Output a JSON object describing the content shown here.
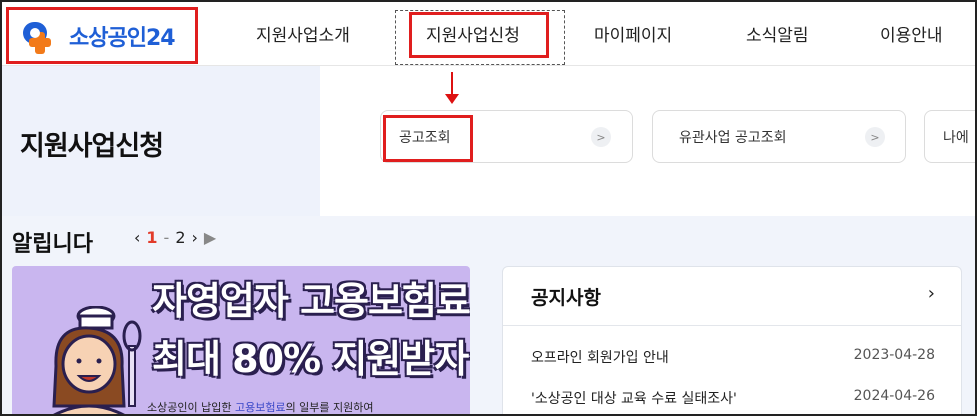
{
  "header": {
    "logo_text": "소상공인24",
    "nav": [
      "지원사업소개",
      "지원사업신청",
      "마이페이지",
      "소식알림",
      "이용안내"
    ]
  },
  "page": {
    "title": "지원사업신청",
    "sub_cards": [
      "공고조회",
      "유관사업 공고조회",
      "나에"
    ]
  },
  "notices": {
    "title": "알립니다",
    "pager": {
      "current": "1",
      "sep": "-",
      "next_page": "2"
    },
    "banner": {
      "line1": "자영업자 고용보험료",
      "line2": "최대 80% 지원받자!",
      "sub_prefix": "소상공인이 납입한 ",
      "sub_highlight": "고용보험료",
      "sub_suffix": "의 일부를 지원하여"
    },
    "board": {
      "title": "공지사항",
      "more": "›",
      "items": [
        {
          "title": "오프라인 회원가입 안내",
          "date": "2023-04-28"
        },
        {
          "title": "'소상공인 대상 교육 수료 실태조사'",
          "date": "2024-04-26"
        }
      ]
    }
  },
  "colors": {
    "brand_blue": "#1f5fd6",
    "highlight_red": "#e01e1e",
    "banner_purple": "#c9b6ef"
  }
}
